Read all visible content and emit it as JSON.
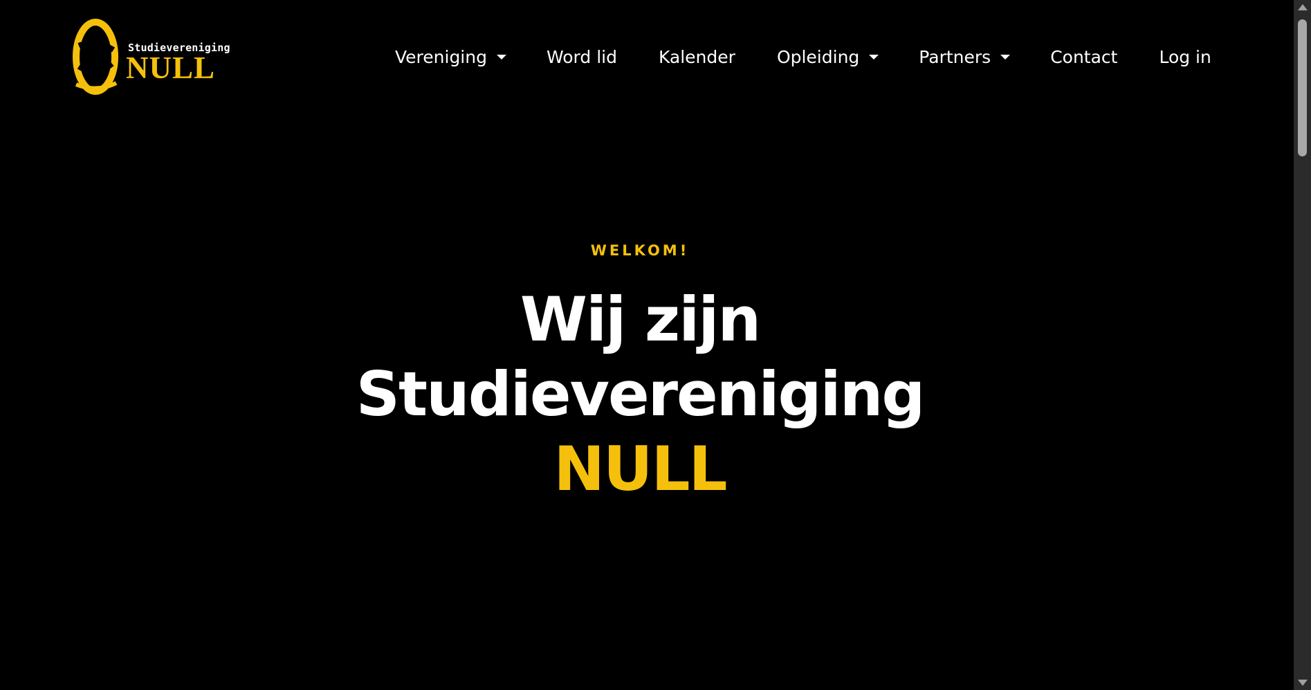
{
  "colors": {
    "background": "#000000",
    "accent": "#f5c00c",
    "text": "#ffffff"
  },
  "logo": {
    "small_text": "Studievereniging",
    "big_text": "NULL"
  },
  "nav": {
    "items": [
      {
        "label": "Vereniging",
        "dropdown": true
      },
      {
        "label": "Word lid",
        "dropdown": false
      },
      {
        "label": "Kalender",
        "dropdown": false
      },
      {
        "label": "Opleiding",
        "dropdown": true
      },
      {
        "label": "Partners",
        "dropdown": true
      },
      {
        "label": "Contact",
        "dropdown": false
      },
      {
        "label": "Log in",
        "dropdown": false
      }
    ]
  },
  "hero": {
    "eyebrow": "WELKOM!",
    "line1": "Wij zijn",
    "line2": "Studievereniging",
    "accent": "NULL"
  }
}
